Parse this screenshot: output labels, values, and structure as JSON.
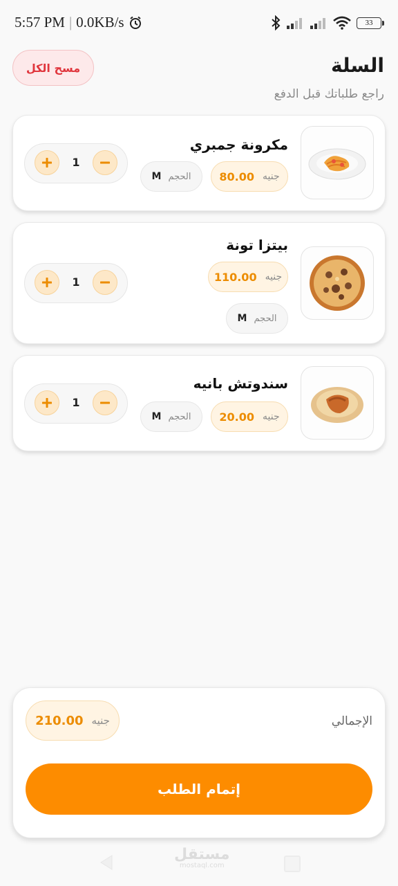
{
  "status_bar": {
    "time": "5:57 PM",
    "speed": "0.0KB/s",
    "battery": "33"
  },
  "header": {
    "title": "السلة",
    "subtitle": "راجع طلباتك قبل الدفع",
    "clear_all": "مسح الكل"
  },
  "items": [
    {
      "name": "مكرونة جمبري",
      "currency": "جنيه",
      "price": "80.00",
      "size_label": "الحجم",
      "size": "M",
      "quantity": "1",
      "image": "shrimp-pasta"
    },
    {
      "name": "بيتزا تونة",
      "currency": "جنيه",
      "price": "110.00",
      "size_label": "الحجم",
      "size": "M",
      "quantity": "1",
      "image": "tuna-pizza"
    },
    {
      "name": "سندوتش بانيه",
      "currency": "جنيه",
      "price": "20.00",
      "size_label": "الحجم",
      "size": "M",
      "quantity": "1",
      "image": "pane-sandwich"
    }
  ],
  "summary": {
    "total_label": "الإجمالي",
    "currency": "جنيه",
    "total": "210.00",
    "checkout": "إتمام الطلب"
  },
  "watermark": {
    "arabic": "مستقل",
    "latin": "mostaql.com"
  },
  "colors": {
    "accent": "#fd8c00",
    "price_text": "#ec8c00",
    "danger": "#e0363d"
  },
  "icons": [
    "alarm-icon",
    "bluetooth-icon",
    "signal-icon",
    "wifi-icon",
    "battery-icon",
    "plus-icon",
    "minus-icon",
    "back-icon",
    "recent-apps-icon"
  ]
}
